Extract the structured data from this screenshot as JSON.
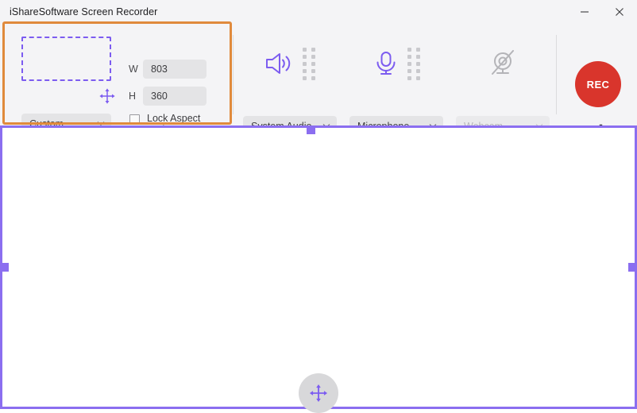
{
  "window": {
    "title": "iShareSoftware Screen Recorder",
    "controls": [
      {
        "name": "minimize",
        "glyph": "–"
      },
      {
        "name": "close",
        "glyph": "✕"
      }
    ]
  },
  "region": {
    "width_label": "W",
    "width_value": "803",
    "height_label": "H",
    "height_value": "360",
    "preset_value": "Custom",
    "lock_label": "Lock Aspect Ratio",
    "lock_checked": false,
    "preview_icon": "move-arrows-icon",
    "dashed_border_color": "#7c5cf0"
  },
  "devices": [
    {
      "id": "system-audio",
      "icon": "speaker-icon",
      "label": "System Audio",
      "enabled": true,
      "meter_levels": 10
    },
    {
      "id": "microphone",
      "icon": "microphone-icon",
      "label": "Microphone",
      "enabled": true,
      "meter_levels": 10
    },
    {
      "id": "webcam",
      "icon": "webcam-disabled-icon",
      "label": "Webcam",
      "enabled": false,
      "meter_levels": 0
    }
  ],
  "record": {
    "button_label": "REC",
    "button_color": "#d9352c",
    "settings_icon": "gear-icon",
    "settings_chevron": "chevron-down-icon"
  },
  "capture_area": {
    "selection_color": "#8b6ef0",
    "center_icon": "move-arrows-icon",
    "handles": [
      "top-center",
      "right-center",
      "bottom-center",
      "left-center"
    ]
  },
  "annotation": {
    "color": "#e08a3c",
    "target": "region-panel"
  },
  "icons": {
    "chevron_down": "⌄"
  }
}
